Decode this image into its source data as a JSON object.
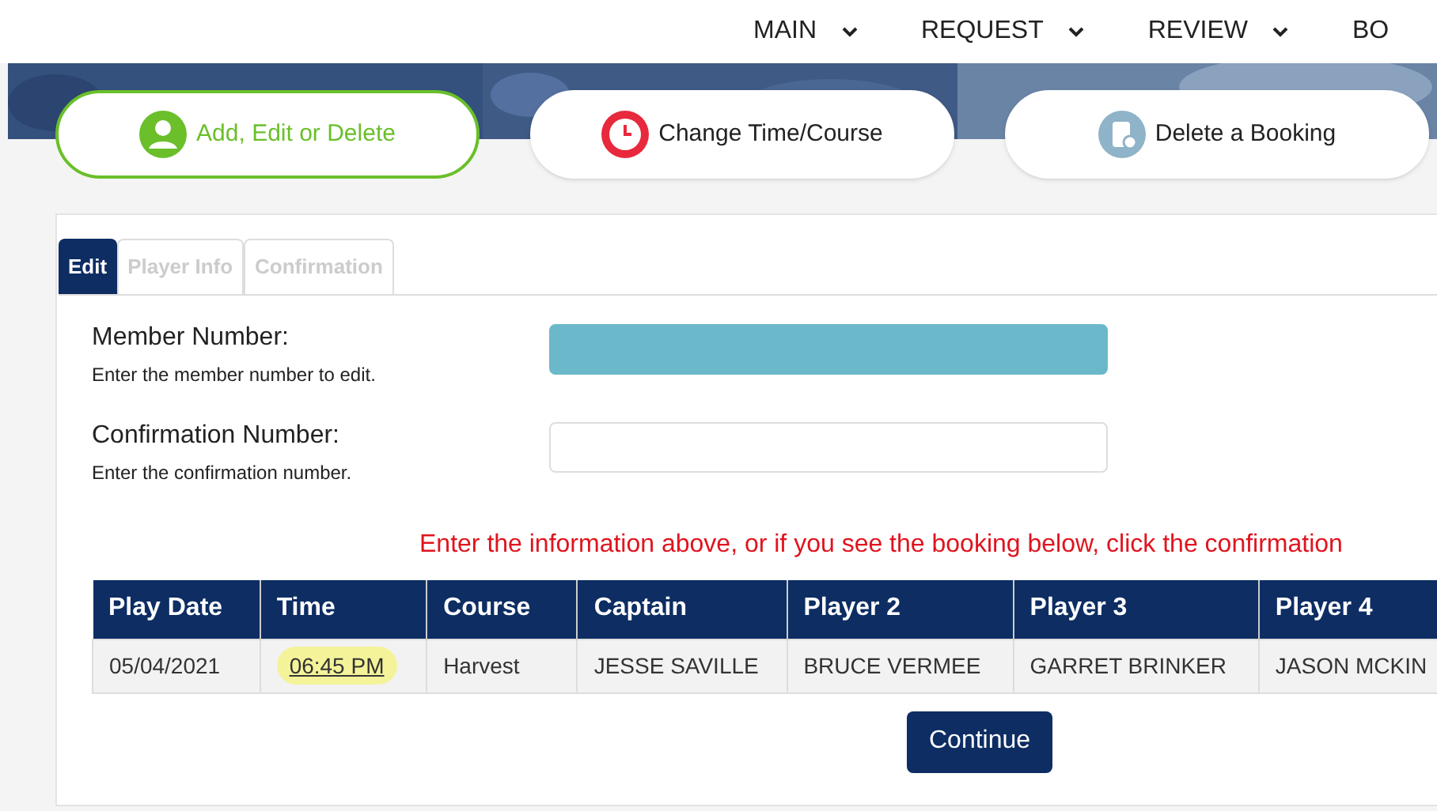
{
  "nav": {
    "items": [
      {
        "label": "MAIN"
      },
      {
        "label": "REQUEST"
      },
      {
        "label": "REVIEW"
      },
      {
        "label": "BO"
      }
    ]
  },
  "actions": [
    {
      "label": "Add, Edit or Delete",
      "kind": "person",
      "selected": true
    },
    {
      "label": "Change Time/Course",
      "kind": "clock",
      "selected": false
    },
    {
      "label": "Delete a Booking",
      "kind": "device",
      "selected": false
    }
  ],
  "tabs": [
    {
      "label": "Edit",
      "selected": true
    },
    {
      "label": "Player Info",
      "selected": false
    },
    {
      "label": "Confirmation",
      "selected": false
    }
  ],
  "fields": [
    {
      "label": "Member Number:",
      "hint": "Enter the member number to edit.",
      "filled": true
    },
    {
      "label": "Confirmation Number:",
      "hint": "Enter the confirmation number.",
      "filled": false
    }
  ],
  "instruction": "Enter the information above, or if you see the booking below, click the confirmation",
  "table": {
    "columns": [
      "Play Date",
      "Time",
      "Course",
      "Captain",
      "Player 2",
      "Player 3",
      "Player 4"
    ],
    "rows": [
      {
        "cells": [
          {
            "text": "05/04/2021",
            "kind": "text"
          },
          {
            "text": "06:45 PM",
            "kind": "link"
          },
          {
            "text": "Harvest",
            "kind": "text"
          },
          {
            "text": "JESSE SAVILLE",
            "kind": "text"
          },
          {
            "text": "BRUCE VERMEE",
            "kind": "text"
          },
          {
            "text": "GARRET BRINKER",
            "kind": "text"
          },
          {
            "text": "JASON MCKIN",
            "kind": "text"
          }
        ],
        "highlighted": true
      }
    ]
  },
  "continue_button": "Continue"
}
